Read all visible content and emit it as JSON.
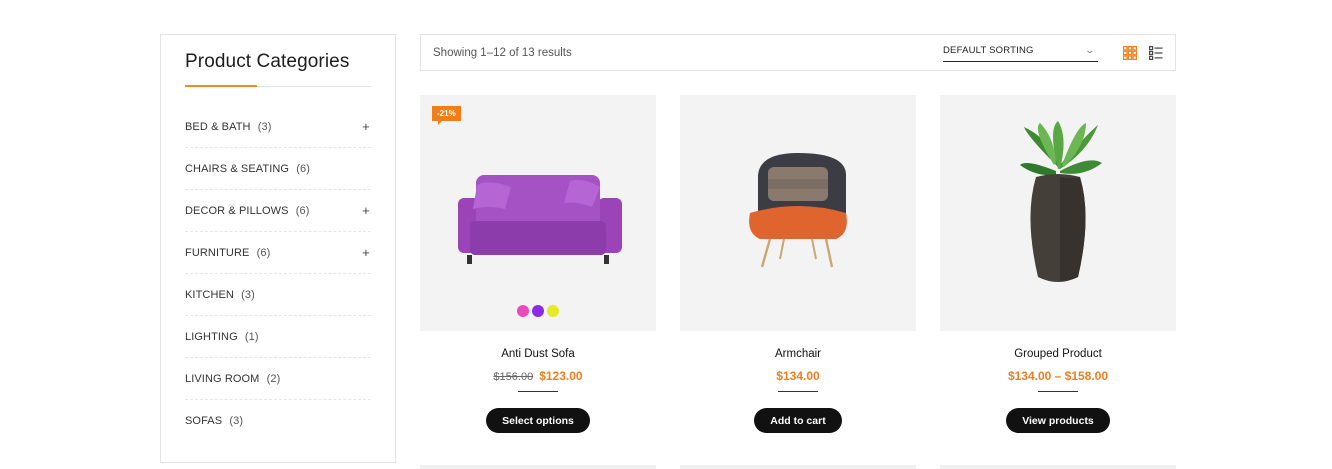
{
  "sidebar": {
    "title": "Product Categories",
    "categories": [
      {
        "name": "BED & BATH",
        "count": "(3)",
        "expand": "+"
      },
      {
        "name": "CHAIRS & SEATING",
        "count": "(6)",
        "expand": ""
      },
      {
        "name": "DECOR & PILLOWS",
        "count": "(6)",
        "expand": "+"
      },
      {
        "name": "FURNITURE",
        "count": "(6)",
        "expand": "+"
      },
      {
        "name": "KITCHEN",
        "count": "(3)",
        "expand": ""
      },
      {
        "name": "LIGHTING",
        "count": "(1)",
        "expand": ""
      },
      {
        "name": "LIVING ROOM",
        "count": "(2)",
        "expand": ""
      },
      {
        "name": "SOFAS",
        "count": "(3)",
        "expand": ""
      }
    ]
  },
  "toolbar": {
    "result_count": "Showing 1–12 of 13 results",
    "sort_selected": "DEFAULT SORTING",
    "grid_view_icon": "grid-view-icon",
    "list_view_icon": "list-view-icon"
  },
  "products": [
    {
      "name": "Anti Dust Sofa",
      "badge": "-21%",
      "old_price": "$156.00",
      "price": "$123.00",
      "button": "Select options",
      "swatches": [
        "#e94bbd",
        "#8a2be2",
        "#e8e82a"
      ]
    },
    {
      "name": "Armchair",
      "price": "$134.00",
      "button": "Add to cart"
    },
    {
      "name": "Grouped Product",
      "price": "$134.00 – $158.00",
      "button": "View products"
    }
  ],
  "colors": {
    "accent": "#f07e1b",
    "button": "#111111"
  }
}
